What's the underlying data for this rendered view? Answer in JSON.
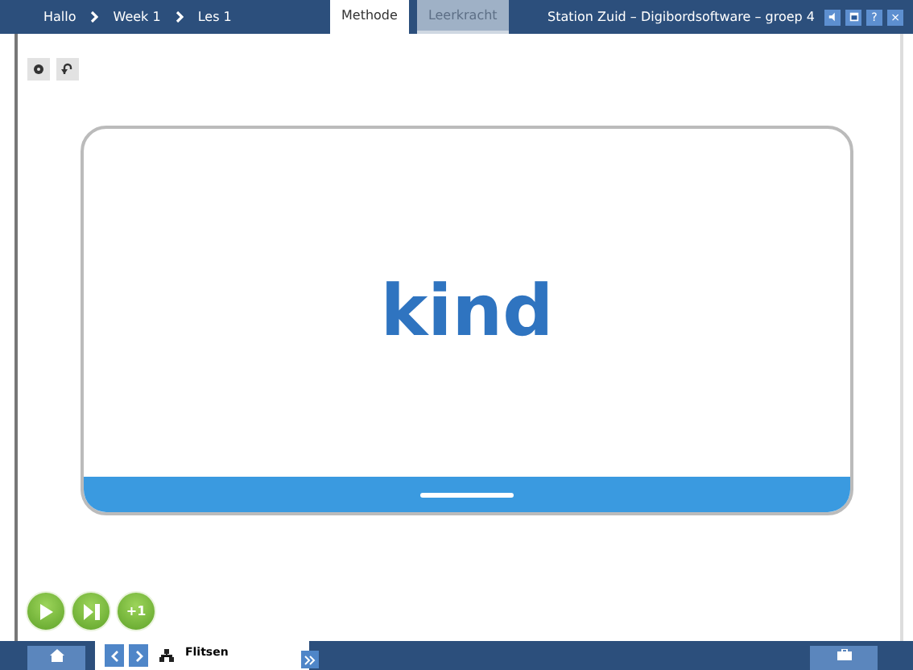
{
  "breadcrumb": [
    {
      "label": "Hallo"
    },
    {
      "label": "Week 1"
    },
    {
      "label": "Les 1"
    }
  ],
  "tabs": [
    {
      "label": "Methode",
      "selected": true
    },
    {
      "label": "Leerkracht",
      "selected": false
    }
  ],
  "window": {
    "title": "Station Zuid – Digibordsoftware – groep 4",
    "buttons": [
      {
        "kind": "sound"
      },
      {
        "kind": "screen"
      },
      {
        "kind": "help",
        "label": "?"
      },
      {
        "kind": "close",
        "label": "×"
      }
    ]
  },
  "card": {
    "word": "kind"
  },
  "controls": [
    {
      "kind": "play"
    },
    {
      "kind": "next"
    },
    {
      "kind": "plus",
      "label": "+1"
    }
  ],
  "footer": {
    "activity": "Flitsen"
  }
}
